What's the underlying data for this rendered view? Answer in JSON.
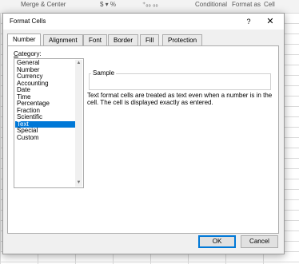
{
  "ribbon": {
    "merge_center": "Merge & Center",
    "currency": "$ ▾ %",
    "decimals": "⁺₀₀ ₀₀",
    "conditional": "Conditional",
    "format_as": "Format as",
    "cell": "Cell"
  },
  "dialog": {
    "title": "Format Cells",
    "help": "?",
    "close": "✕",
    "tabs": [
      "Number",
      "Alignment",
      "Font",
      "Border",
      "Fill",
      "Protection"
    ],
    "active_tab": "Number",
    "category_label": "Category:",
    "categories": [
      "General",
      "Number",
      "Currency",
      "Accounting",
      "Date",
      "Time",
      "Percentage",
      "Fraction",
      "Scientific",
      "Text",
      "Special",
      "Custom"
    ],
    "selected_category": "Text",
    "sample_label": "Sample",
    "description": "Text format cells are treated as text even when a number is in the cell. The cell is displayed exactly as entered.",
    "ok": "OK",
    "cancel": "Cancel"
  },
  "colors": {
    "selection": "#0078d7"
  },
  "icons": {
    "scroll_up": "chevron-up-icon",
    "scroll_down": "chevron-down-icon"
  }
}
